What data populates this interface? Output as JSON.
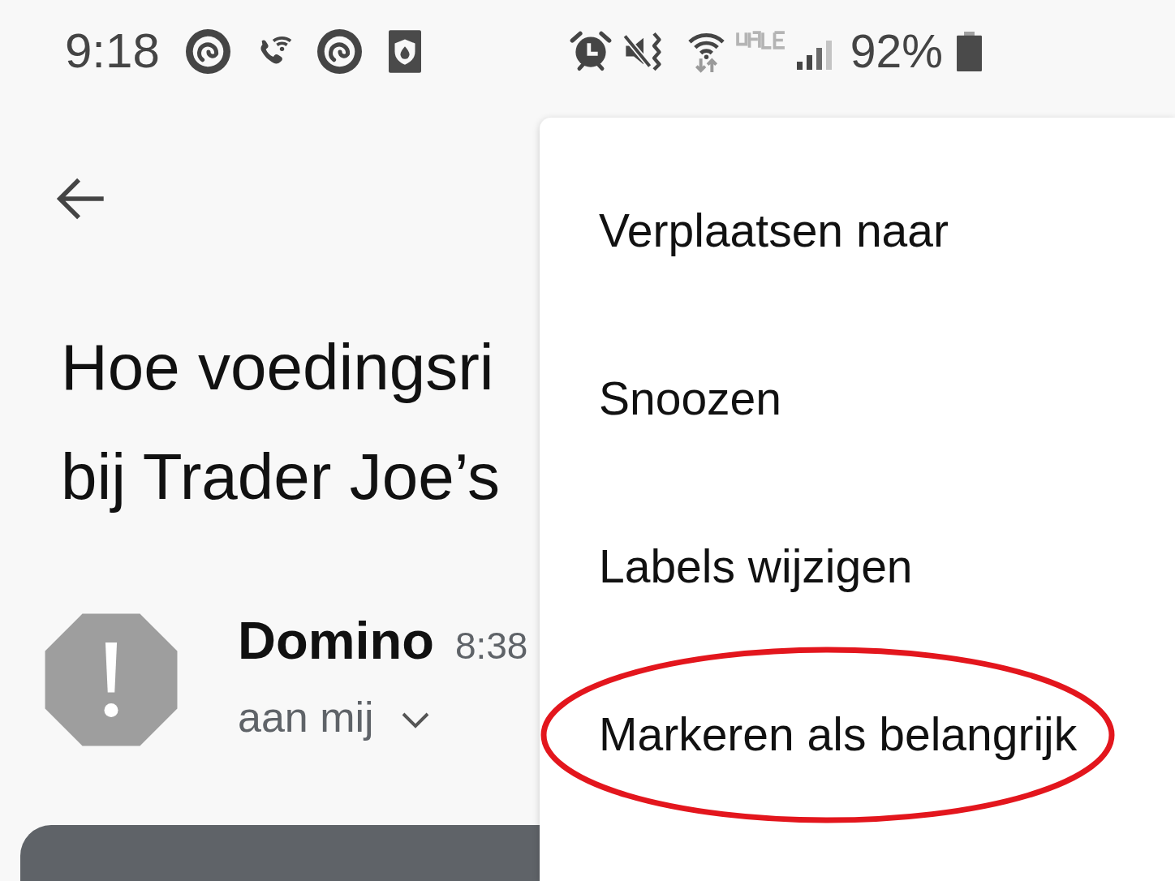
{
  "status_bar": {
    "time": "9:18",
    "battery": "92%"
  },
  "email": {
    "subject_lines": [
      "Hoe voedingsri",
      "bij Trader Joe’s"
    ],
    "sender": "Domino",
    "time": "8:38",
    "recipient": "aan mij"
  },
  "menu": {
    "items": [
      {
        "label": "Verplaatsen naar",
        "circled": false
      },
      {
        "label": "Snoozen",
        "circled": false
      },
      {
        "label": "Labels wijzigen",
        "circled": false
      },
      {
        "label": "Markeren als belangrijk",
        "circled": true
      }
    ]
  }
}
